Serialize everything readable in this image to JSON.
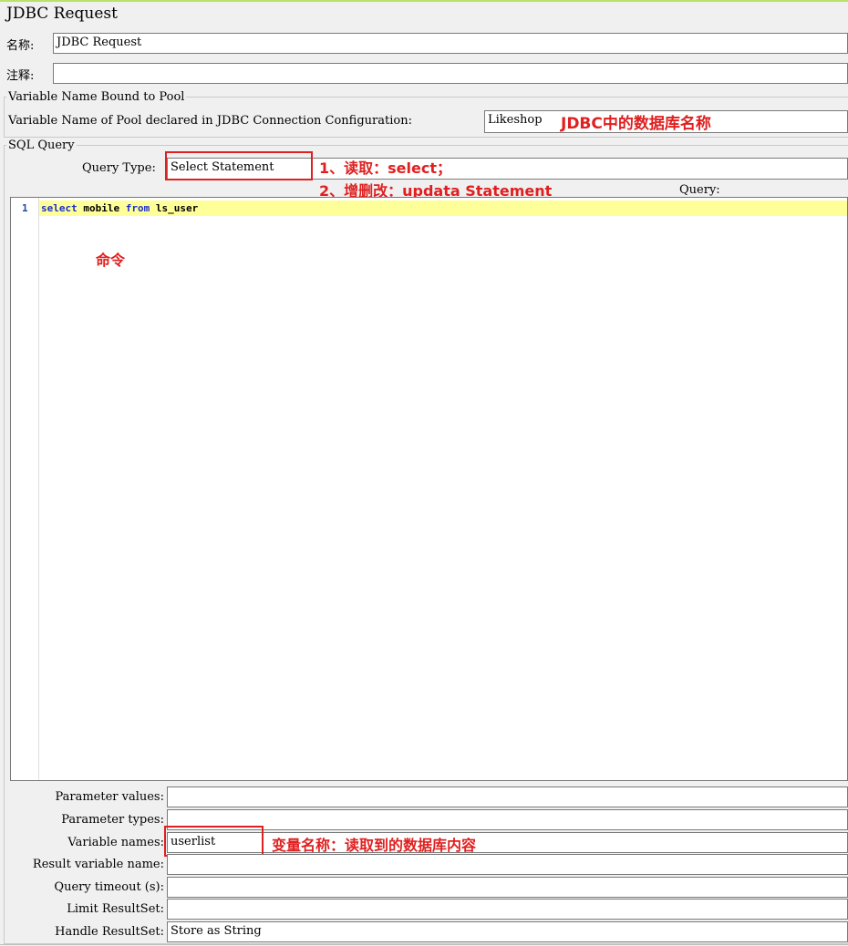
{
  "title": "JDBC Request",
  "name_label": "名称:",
  "name_value": "JDBC Request",
  "comment_label": "注释:",
  "comment_value": "",
  "pool_group_title": "Variable Name Bound to Pool",
  "pool_label": "Variable Name of Pool declared in JDBC Connection Configuration:",
  "pool_value": "Likeshop",
  "pool_annotation": "JDBC中的数据库名称",
  "sql_group_title": "SQL Query",
  "query_type_label": "Query Type:",
  "query_type_value": "Select Statement",
  "query_type_annotation_1": "1、读取：select；",
  "query_type_annotation_2": "2、增删改：updata Statement",
  "query_label": "Query:",
  "editor": {
    "line_number": "1",
    "kw_select": "select",
    "col": " mobile ",
    "kw_from": "from",
    "table": " ls_user",
    "annotation": "命令"
  },
  "params": {
    "parameter_values_label": "Parameter values:",
    "parameter_values": "",
    "parameter_types_label": "Parameter types:",
    "parameter_types": "",
    "variable_names_label": "Variable names:",
    "variable_names": "userlist",
    "variable_names_annotation": "变量名称：读取到的数据库内容",
    "result_variable_name_label": "Result variable name:",
    "result_variable_name": "",
    "query_timeout_label": "Query timeout (s):",
    "query_timeout": "",
    "limit_resultset_label": "Limit ResultSet:",
    "limit_resultset": "",
    "handle_resultset_label": "Handle ResultSet:",
    "handle_resultset": "Store as String"
  },
  "colors": {
    "annotation_red": "#e02020",
    "current_line": "#ffff99",
    "keyword_blue": "#1a2ecc"
  }
}
